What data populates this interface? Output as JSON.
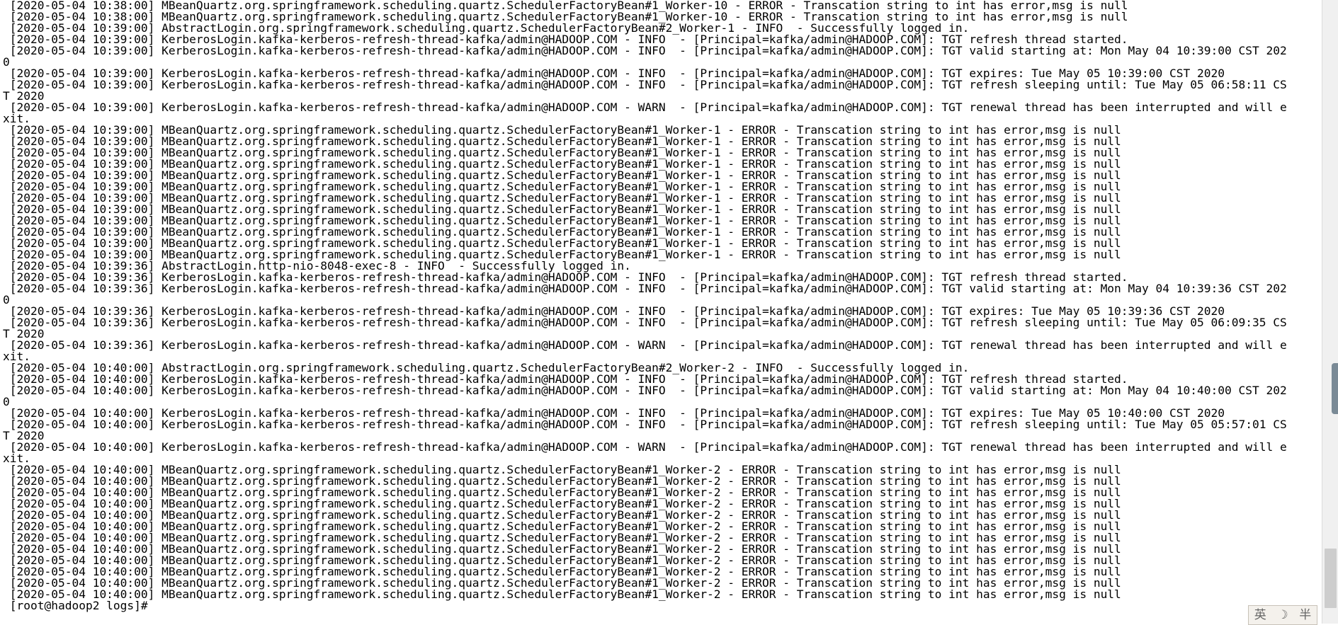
{
  "terminal": {
    "lines": [
      " [2020-05-04 10:38:00] MBeanQuartz.org.springframework.scheduling.quartz.SchedulerFactoryBean#1_Worker-10 - ERROR - Transcation string to int has error,msg is null",
      " [2020-05-04 10:38:00] MBeanQuartz.org.springframework.scheduling.quartz.SchedulerFactoryBean#1_Worker-10 - ERROR - Transcation string to int has error,msg is null",
      " [2020-05-04 10:39:00] AbstractLogin.org.springframework.scheduling.quartz.SchedulerFactoryBean#2_Worker-1 - INFO  - Successfully logged in.",
      " [2020-05-04 10:39:00] KerberosLogin.kafka-kerberos-refresh-thread-kafka/admin@HADOOP.COM - INFO  - [Principal=kafka/admin@HADOOP.COM]: TGT refresh thread started.",
      " [2020-05-04 10:39:00] KerberosLogin.kafka-kerberos-refresh-thread-kafka/admin@HADOOP.COM - INFO  - [Principal=kafka/admin@HADOOP.COM]: TGT valid starting at: Mon May 04 10:39:00 CST 202",
      "0",
      " [2020-05-04 10:39:00] KerberosLogin.kafka-kerberos-refresh-thread-kafka/admin@HADOOP.COM - INFO  - [Principal=kafka/admin@HADOOP.COM]: TGT expires: Tue May 05 10:39:00 CST 2020",
      " [2020-05-04 10:39:00] KerberosLogin.kafka-kerberos-refresh-thread-kafka/admin@HADOOP.COM - INFO  - [Principal=kafka/admin@HADOOP.COM]: TGT refresh sleeping until: Tue May 05 06:58:11 CS",
      "T 2020",
      " [2020-05-04 10:39:00] KerberosLogin.kafka-kerberos-refresh-thread-kafka/admin@HADOOP.COM - WARN  - [Principal=kafka/admin@HADOOP.COM]: TGT renewal thread has been interrupted and will e",
      "xit.",
      " [2020-05-04 10:39:00] MBeanQuartz.org.springframework.scheduling.quartz.SchedulerFactoryBean#1_Worker-1 - ERROR - Transcation string to int has error,msg is null",
      " [2020-05-04 10:39:00] MBeanQuartz.org.springframework.scheduling.quartz.SchedulerFactoryBean#1_Worker-1 - ERROR - Transcation string to int has error,msg is null",
      " [2020-05-04 10:39:00] MBeanQuartz.org.springframework.scheduling.quartz.SchedulerFactoryBean#1_Worker-1 - ERROR - Transcation string to int has error,msg is null",
      " [2020-05-04 10:39:00] MBeanQuartz.org.springframework.scheduling.quartz.SchedulerFactoryBean#1_Worker-1 - ERROR - Transcation string to int has error,msg is null",
      " [2020-05-04 10:39:00] MBeanQuartz.org.springframework.scheduling.quartz.SchedulerFactoryBean#1_Worker-1 - ERROR - Transcation string to int has error,msg is null",
      " [2020-05-04 10:39:00] MBeanQuartz.org.springframework.scheduling.quartz.SchedulerFactoryBean#1_Worker-1 - ERROR - Transcation string to int has error,msg is null",
      " [2020-05-04 10:39:00] MBeanQuartz.org.springframework.scheduling.quartz.SchedulerFactoryBean#1_Worker-1 - ERROR - Transcation string to int has error,msg is null",
      " [2020-05-04 10:39:00] MBeanQuartz.org.springframework.scheduling.quartz.SchedulerFactoryBean#1_Worker-1 - ERROR - Transcation string to int has error,msg is null",
      " [2020-05-04 10:39:00] MBeanQuartz.org.springframework.scheduling.quartz.SchedulerFactoryBean#1_Worker-1 - ERROR - Transcation string to int has error,msg is null",
      " [2020-05-04 10:39:00] MBeanQuartz.org.springframework.scheduling.quartz.SchedulerFactoryBean#1_Worker-1 - ERROR - Transcation string to int has error,msg is null",
      " [2020-05-04 10:39:00] MBeanQuartz.org.springframework.scheduling.quartz.SchedulerFactoryBean#1_Worker-1 - ERROR - Transcation string to int has error,msg is null",
      " [2020-05-04 10:39:00] MBeanQuartz.org.springframework.scheduling.quartz.SchedulerFactoryBean#1_Worker-1 - ERROR - Transcation string to int has error,msg is null",
      " [2020-05-04 10:39:36] AbstractLogin.http-nio-8048-exec-8 - INFO  - Successfully logged in.",
      " [2020-05-04 10:39:36] KerberosLogin.kafka-kerberos-refresh-thread-kafka/admin@HADOOP.COM - INFO  - [Principal=kafka/admin@HADOOP.COM]: TGT refresh thread started.",
      " [2020-05-04 10:39:36] KerberosLogin.kafka-kerberos-refresh-thread-kafka/admin@HADOOP.COM - INFO  - [Principal=kafka/admin@HADOOP.COM]: TGT valid starting at: Mon May 04 10:39:36 CST 202",
      "0",
      " [2020-05-04 10:39:36] KerberosLogin.kafka-kerberos-refresh-thread-kafka/admin@HADOOP.COM - INFO  - [Principal=kafka/admin@HADOOP.COM]: TGT expires: Tue May 05 10:39:36 CST 2020",
      " [2020-05-04 10:39:36] KerberosLogin.kafka-kerberos-refresh-thread-kafka/admin@HADOOP.COM - INFO  - [Principal=kafka/admin@HADOOP.COM]: TGT refresh sleeping until: Tue May 05 06:09:35 CS",
      "T 2020",
      " [2020-05-04 10:39:36] KerberosLogin.kafka-kerberos-refresh-thread-kafka/admin@HADOOP.COM - WARN  - [Principal=kafka/admin@HADOOP.COM]: TGT renewal thread has been interrupted and will e",
      "xit.",
      " [2020-05-04 10:40:00] AbstractLogin.org.springframework.scheduling.quartz.SchedulerFactoryBean#2_Worker-2 - INFO  - Successfully logged in.",
      " [2020-05-04 10:40:00] KerberosLogin.kafka-kerberos-refresh-thread-kafka/admin@HADOOP.COM - INFO  - [Principal=kafka/admin@HADOOP.COM]: TGT refresh thread started.",
      " [2020-05-04 10:40:00] KerberosLogin.kafka-kerberos-refresh-thread-kafka/admin@HADOOP.COM - INFO  - [Principal=kafka/admin@HADOOP.COM]: TGT valid starting at: Mon May 04 10:40:00 CST 202",
      "0",
      " [2020-05-04 10:40:00] KerberosLogin.kafka-kerberos-refresh-thread-kafka/admin@HADOOP.COM - INFO  - [Principal=kafka/admin@HADOOP.COM]: TGT expires: Tue May 05 10:40:00 CST 2020",
      " [2020-05-04 10:40:00] KerberosLogin.kafka-kerberos-refresh-thread-kafka/admin@HADOOP.COM - INFO  - [Principal=kafka/admin@HADOOP.COM]: TGT refresh sleeping until: Tue May 05 05:57:01 CS",
      "T 2020",
      " [2020-05-04 10:40:00] KerberosLogin.kafka-kerberos-refresh-thread-kafka/admin@HADOOP.COM - WARN  - [Principal=kafka/admin@HADOOP.COM]: TGT renewal thread has been interrupted and will e",
      "xit.",
      " [2020-05-04 10:40:00] MBeanQuartz.org.springframework.scheduling.quartz.SchedulerFactoryBean#1_Worker-2 - ERROR - Transcation string to int has error,msg is null",
      " [2020-05-04 10:40:00] MBeanQuartz.org.springframework.scheduling.quartz.SchedulerFactoryBean#1_Worker-2 - ERROR - Transcation string to int has error,msg is null",
      " [2020-05-04 10:40:00] MBeanQuartz.org.springframework.scheduling.quartz.SchedulerFactoryBean#1_Worker-2 - ERROR - Transcation string to int has error,msg is null",
      " [2020-05-04 10:40:00] MBeanQuartz.org.springframework.scheduling.quartz.SchedulerFactoryBean#1_Worker-2 - ERROR - Transcation string to int has error,msg is null",
      " [2020-05-04 10:40:00] MBeanQuartz.org.springframework.scheduling.quartz.SchedulerFactoryBean#1_Worker-2 - ERROR - Transcation string to int has error,msg is null",
      " [2020-05-04 10:40:00] MBeanQuartz.org.springframework.scheduling.quartz.SchedulerFactoryBean#1_Worker-2 - ERROR - Transcation string to int has error,msg is null",
      " [2020-05-04 10:40:00] MBeanQuartz.org.springframework.scheduling.quartz.SchedulerFactoryBean#1_Worker-2 - ERROR - Transcation string to int has error,msg is null",
      " [2020-05-04 10:40:00] MBeanQuartz.org.springframework.scheduling.quartz.SchedulerFactoryBean#1_Worker-2 - ERROR - Transcation string to int has error,msg is null",
      " [2020-05-04 10:40:00] MBeanQuartz.org.springframework.scheduling.quartz.SchedulerFactoryBean#1_Worker-2 - ERROR - Transcation string to int has error,msg is null",
      " [2020-05-04 10:40:00] MBeanQuartz.org.springframework.scheduling.quartz.SchedulerFactoryBean#1_Worker-2 - ERROR - Transcation string to int has error,msg is null",
      " [2020-05-04 10:40:00] MBeanQuartz.org.springframework.scheduling.quartz.SchedulerFactoryBean#1_Worker-2 - ERROR - Transcation string to int has error,msg is null",
      " [2020-05-04 10:40:00] MBeanQuartz.org.springframework.scheduling.quartz.SchedulerFactoryBean#1_Worker-2 - ERROR - Transcation string to int has error,msg is null",
      " [root@hadoop2 logs]#"
    ]
  },
  "ime": {
    "lang": "英",
    "moon": "☽",
    "half": "半"
  }
}
